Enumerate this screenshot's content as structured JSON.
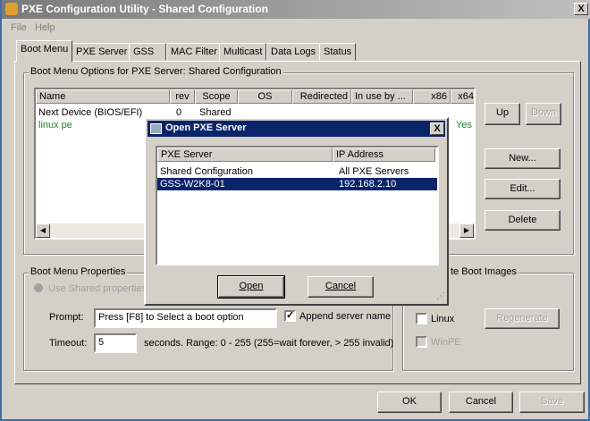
{
  "window": {
    "title": "PXE Configuration Utility - Shared Configuration",
    "close": "X"
  },
  "menu": [
    "File",
    "Help"
  ],
  "tabs": [
    "Boot Menu",
    "PXE Server",
    "GSS",
    "MAC Filter",
    "Multicast",
    "Data Logs",
    "Status"
  ],
  "boot_options": {
    "group_label": "Boot Menu Options for PXE Server:  Shared Configuration",
    "columns": [
      "Name",
      "rev",
      "Scope",
      "OS",
      "Redirected",
      "In use by ...",
      "x86",
      "x64"
    ],
    "rows": [
      {
        "name": "Next Device (BIOS/EFI)",
        "rev": "0",
        "scope": "Shared",
        "x64": ""
      },
      {
        "name": "linux pe",
        "rev": "",
        "scope": "",
        "x64": "Yes"
      }
    ],
    "buttons": {
      "up": "Up",
      "down": "Down",
      "new": "New...",
      "edit": "Edit...",
      "delete": "Delete"
    }
  },
  "properties": {
    "group_label": "Boot Menu Properties",
    "use_shared": "Use Shared properties",
    "prompt_label": "Prompt:",
    "prompt_value": "Press [F8] to Select a boot option",
    "append_label": "Append server name",
    "timeout_label": "Timeout:",
    "timeout_value": "5",
    "timeout_hint": "seconds.  Range: 0 - 255 (255=wait forever, > 255 invalid)"
  },
  "images": {
    "group_label": "te Boot Images",
    "linux": "Linux",
    "winpe": "WinPE",
    "regenerate": "Regenerate"
  },
  "footer": {
    "ok": "OK",
    "cancel": "Cancel",
    "save": "Save"
  },
  "dialog": {
    "title": "Open PXE Server",
    "close": "X",
    "columns": [
      "PXE Server",
      "IP Address"
    ],
    "rows": [
      {
        "server": "Shared Configuration",
        "ip": "All PXE Servers"
      },
      {
        "server": "GSS-W2K8-01",
        "ip": "192.168.2.10"
      }
    ],
    "open": "Open",
    "cancel": "Cancel"
  }
}
